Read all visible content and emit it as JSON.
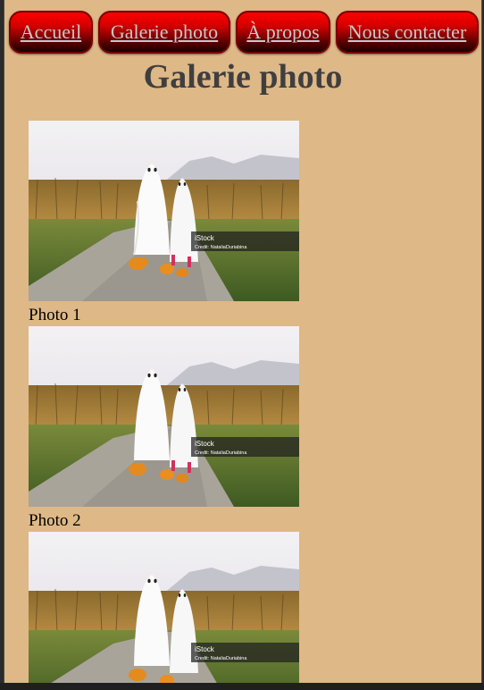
{
  "nav": {
    "items": [
      {
        "label": "Accueil"
      },
      {
        "label": "Galerie photo"
      },
      {
        "label": "À propos"
      },
      {
        "label": "Nous contacter"
      }
    ]
  },
  "page_title": "Galerie photo",
  "photos": [
    {
      "caption": "Photo 1",
      "watermark_brand": "iStock",
      "watermark_credit": "Credit: NataliaDuriabina"
    },
    {
      "caption": "Photo 2",
      "watermark_brand": "iStock",
      "watermark_credit": "Credit: NataliaDuriabina"
    },
    {
      "caption": "",
      "watermark_brand": "iStock",
      "watermark_credit": "Credit: NataliaDuriabina"
    }
  ],
  "colors": {
    "page_background": "#deb887",
    "nav_button_red": "#ff0000",
    "nav_text": "#c8c8c8",
    "title_text": "#3f3f3f"
  }
}
